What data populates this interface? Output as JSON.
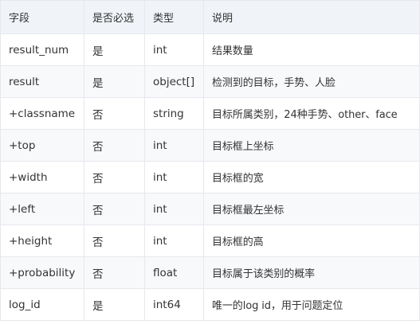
{
  "table": {
    "headers": [
      "字段",
      "是否必选",
      "类型",
      "说明"
    ],
    "rows": [
      [
        "result_num",
        "是",
        "int",
        "结果数量"
      ],
      [
        "result",
        "是",
        "object[]",
        "检测到的目标，手势、人脸"
      ],
      [
        "+classname",
        "否",
        "string",
        "目标所属类别，24种手势、other、face"
      ],
      [
        "+top",
        "否",
        "int",
        "目标框上坐标"
      ],
      [
        "+width",
        "否",
        "int",
        "目标框的宽"
      ],
      [
        "+left",
        "否",
        "int",
        "目标框最左坐标"
      ],
      [
        "+height",
        "否",
        "int",
        "目标框的高"
      ],
      [
        "+probability",
        "否",
        "float",
        "目标属于该类别的概率"
      ],
      [
        "log_id",
        "是",
        "int64",
        "唯一的log id，用于问题定位"
      ]
    ]
  }
}
